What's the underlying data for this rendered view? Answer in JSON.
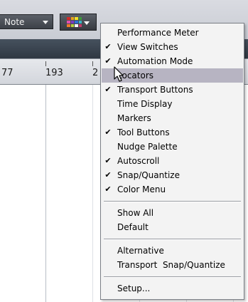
{
  "toolbar": {
    "quantize_select": {
      "value": "Note"
    },
    "color_button": {
      "icon": "color-grid-icon",
      "swatch_colors": [
        "#d22a2a",
        "#e8a21a",
        "#f2e12a",
        "#3b9c3b",
        "#e24fb0",
        "#7c3cc1",
        "#2e6fd6",
        "#3bb4c4",
        "#f07a2a",
        "#b8d43a",
        "#ffffff",
        "#c73a6a"
      ]
    }
  },
  "ruler": {
    "labels": [
      "77",
      "193",
      "2"
    ]
  },
  "context_menu": {
    "items": [
      {
        "label": "Performance Meter",
        "checked": false
      },
      {
        "label": "View Switches",
        "checked": true
      },
      {
        "label": "Automation Mode",
        "checked": true
      },
      {
        "label": "Locators",
        "checked": false,
        "highlighted": true
      },
      {
        "label": "Transport Buttons",
        "checked": true
      },
      {
        "label": "Time Display",
        "checked": false
      },
      {
        "label": "Markers",
        "checked": false
      },
      {
        "label": "Tool Buttons",
        "checked": true
      },
      {
        "label": "Nudge Palette",
        "checked": false
      },
      {
        "label": "Autoscroll",
        "checked": true
      },
      {
        "label": "Snap/Quantize",
        "checked": true
      },
      {
        "label": "Color Menu",
        "checked": true
      },
      {
        "label": "Show All"
      },
      {
        "label": "Default"
      },
      {
        "label": "Alternative"
      },
      {
        "label": "Transport  Snap/Quantize"
      },
      {
        "label": "Setup..."
      }
    ],
    "check_glyph": "✔"
  },
  "colors": {
    "menu_highlight": "#b7b4c2",
    "menu_background": "#f3f3f3",
    "toolbar_background": "#d3d6dc",
    "dark_strip": "#3a444f"
  }
}
